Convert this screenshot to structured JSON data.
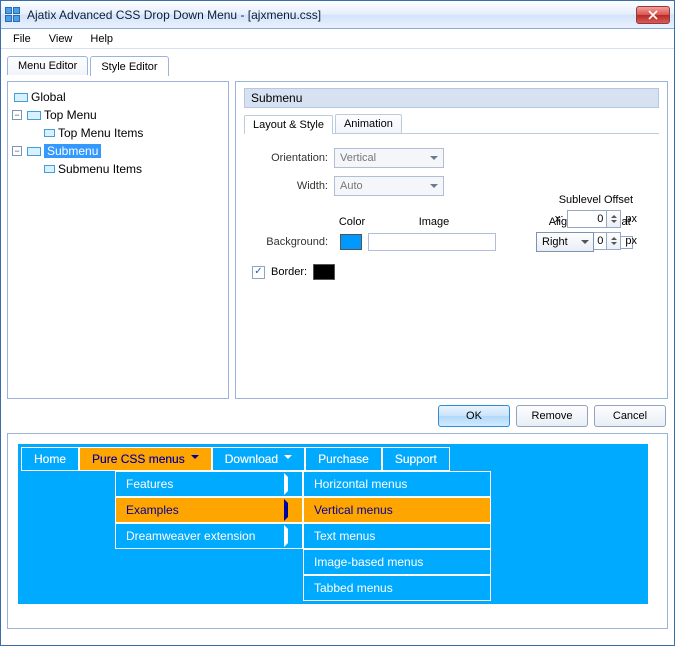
{
  "window": {
    "title": "Ajatix Advanced CSS Drop Down Menu - [ajxmenu.css]"
  },
  "menubar": {
    "file": "File",
    "view": "View",
    "help": "Help"
  },
  "tabs": {
    "menu_editor": "Menu Editor",
    "style_editor": "Style Editor"
  },
  "tree": {
    "global": "Global",
    "top_menu": "Top Menu",
    "top_menu_items": "Top Menu Items",
    "submenu": "Submenu",
    "submenu_items": "Submenu Items"
  },
  "section": {
    "title": "Submenu"
  },
  "subtabs": {
    "layout": "Layout & Style",
    "animation": "Animation"
  },
  "form": {
    "orientation_label": "Orientation:",
    "orientation_value": "Vertical",
    "width_label": "Width:",
    "width_value": "Auto",
    "sublevel_title": "Sublevel Offset",
    "x_label": "x:",
    "x_value": "0",
    "y_label": "y:",
    "y_value": "0",
    "px": "px",
    "color_hdr": "Color",
    "image_hdr": "Image",
    "align_hdr": "Align",
    "repeat_hdr": "Repeat",
    "background_label": "Background:",
    "bg_color": "#0099ff",
    "align_value": "Right",
    "border_label": "Border:",
    "border_color": "#000000"
  },
  "buttons": {
    "ok": "OK",
    "remove": "Remove",
    "cancel": "Cancel"
  },
  "nav": {
    "top": [
      "Home",
      "Pure CSS menus",
      "Download",
      "Purchase",
      "Support"
    ],
    "sub1": [
      "Features",
      "Examples",
      "Dreamweaver extension"
    ],
    "sub2": [
      "Horizontal menus",
      "Vertical menus",
      "Text menus",
      "Image-based menus",
      "Tabbed menus"
    ]
  }
}
